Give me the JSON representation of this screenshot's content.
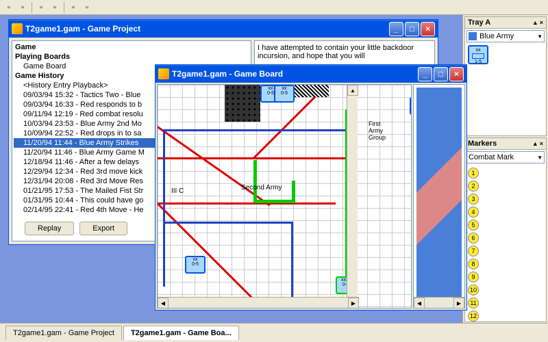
{
  "toolbar": {
    "items": [
      "file",
      "save",
      "cut",
      "copy",
      "paste",
      "undo",
      "redo"
    ]
  },
  "proj_win": {
    "title": "T2game1.gam - Game Project",
    "tree": {
      "game": "Game",
      "boards": "Playing Boards",
      "board_item": "Game Board",
      "history": "Game History",
      "playback": "<History Entry Playback>",
      "entries": [
        "09/03/94 15:32 - Tactics Two - Blue",
        "09/03/94 16:33 - Red responds to b",
        "09/11/94 12:19 - Red combat resolu",
        "10/03/94 23:53 - Blue Army 2nd Mo",
        "10/09/94 22:52 - Red drops in to sa",
        "11/20/94 11:44 - Blue Army Strikes",
        "11/20/94 11:46 - Blue Army Game M",
        "12/18/94 11:46 - After a few delays",
        "12/29/94 12:34 - Red 3rd move kick",
        "12/31/94 20:08 - Red 3rd Move Res",
        "01/21/95 17:53 - The Mailed Fist Str",
        "01/31/95 10:44 - This could have go",
        "02/14/95 22:41 - Red 4th Move - He"
      ],
      "selected_index": 5
    },
    "message": "I have attempted to contain your little backdoor incursion, and hope that you will",
    "replay_btn": "Replay",
    "export_btn": "Export"
  },
  "board_win": {
    "title": "T2game1.gam - Game Board",
    "labels": {
      "second_army": "Second Army",
      "first_army": "First Army Group",
      "iii_c": "III C"
    }
  },
  "right": {
    "tray_title": "Tray A",
    "tray_combo": "Blue Army",
    "unit_label": "1-5",
    "markers_title": "Markers",
    "markers_combo": "Combat Mark",
    "markers": [
      "1",
      "2",
      "3",
      "4",
      "5",
      "6",
      "7",
      "8",
      "9",
      "10",
      "11",
      "12"
    ]
  },
  "tabs": {
    "t1": "T2game1.gam - Game Project",
    "t2": "T2game1.gam - Game Boa..."
  }
}
